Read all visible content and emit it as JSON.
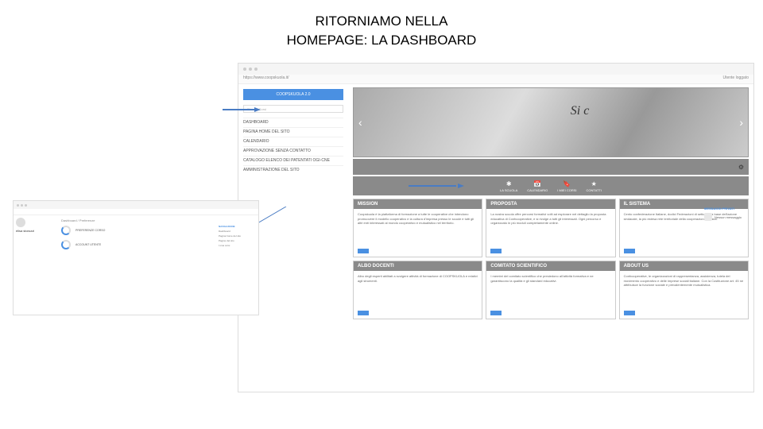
{
  "slide": {
    "title_l1": "RITORNIAMO NELLA",
    "title_l2": "HOMEPAGE: LA DASHBOARD"
  },
  "main": {
    "url": "https://www.coopskuola.it/",
    "user_label": "Utente loggato",
    "logo": "COOPSKUOLA 2.0",
    "search_placeholder": "Ricerca Corsi",
    "hero_script": "Si c",
    "gear_label": "⚙",
    "menu": [
      "DASHBOARD",
      "PAGINA HOME DEL SITO",
      "CALENDARIO",
      "APPROVAZIONE SENZA CONTATTO",
      "CATALOGO ELENCO DEI PATENTATI OGI-CNE",
      "AMMINISTRAZIONE DEL SITO"
    ],
    "nav": [
      {
        "icon": "✱",
        "label": "LA SCUOLA"
      },
      {
        "icon": "📅",
        "label": "CALENDARIO"
      },
      {
        "icon": "🔖",
        "label": "I MIEI CORSI"
      },
      {
        "icon": "★",
        "label": "CONTATTI"
      }
    ],
    "cards": [
      {
        "title": "MISSION",
        "body": "Coopskuola è la piattaforma di formazione a tutte le cooperative che intendono promuovere il modello cooperativo e la cultura d'impresa presso le scuole e tutti gli altri enti interessati al mondo cooperativo e mutualistico nel territorio."
      },
      {
        "title": "PROPOSTA",
        "body": "La nostra scuola offre percorsi formativi volti ad esplorare nel dettaglio la proposta educativa di Confcooperative, e si rivolge a tutti gli interessati. Ogni percorso e organizzato in più moduli completamente online."
      },
      {
        "title": "IL SISTEMA",
        "body": "Cento confederazione Italiane, dodici Federazioni di settore alla base dell'azione sindacale, la più estesa rete territoriale della cooperazione italiana."
      },
      {
        "title": "ALBO DOCENTI",
        "body": "Albo degli esperti abilitati a svolgere attività di formazione di COOPSKUOLA e relativi agli strumenti."
      },
      {
        "title": "COMITATO SCIENTIFICO",
        "body": "I membri del comitato scientifico che presiedono all'attività formativa e ne garantiscono la qualità e gli standard educativi."
      },
      {
        "title": "ABOUT US",
        "body": "Confcooperative, le organizzazioni di rappresentanza, assistenza, tutela del movimento cooperativo e delle imprese sociali italiane. Con la Costituzione art. 45 ne attribuisce la funzione sociale e prevalentemente mutualistica."
      }
    ],
    "sidebar": {
      "heading": "MESSAGGI PRIVATI",
      "item": "Nessun messaggio"
    }
  },
  "secondary": {
    "name": "elisa storozzi",
    "tabs": "Dashboard / Preferenze",
    "blocks": [
      {
        "title": "PREFERENZE CORSO"
      },
      {
        "title": "ACCOUNT UTENTE"
      }
    ],
    "rside": {
      "heading": "NAVIGAZIONE",
      "items": [
        "Dashboard",
        "Pagina home del sito",
        "Pagine del sito",
        "I miei corsi"
      ]
    }
  }
}
